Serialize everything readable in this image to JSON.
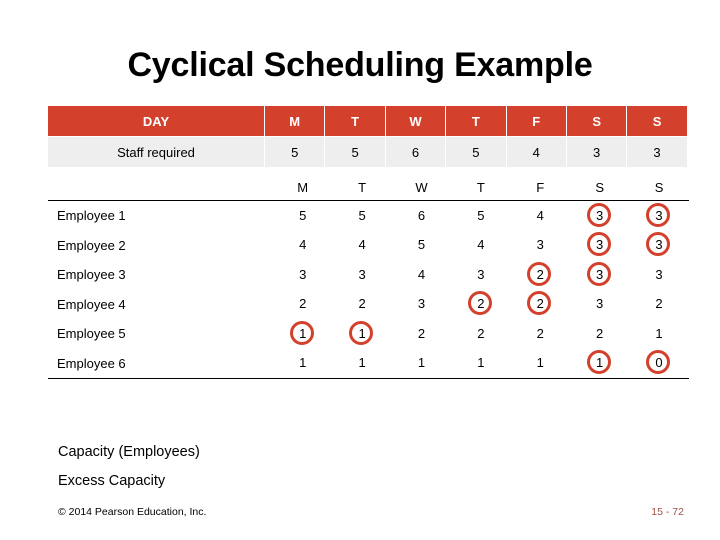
{
  "slide": {
    "title": "Cyclical Scheduling Example",
    "copyright": "© 2014 Pearson Education, Inc.",
    "page_number": "15 - 72",
    "accent_color": "#d3402c",
    "footer_lines": {
      "capacity": "Capacity (Employees)",
      "excess": "Excess Capacity"
    }
  },
  "top_table": {
    "header": {
      "label": "DAY",
      "days": [
        "M",
        "T",
        "W",
        "T",
        "F",
        "S",
        "S"
      ]
    },
    "staff_row": {
      "label": "Staff required",
      "values": [
        "5",
        "5",
        "6",
        "5",
        "4",
        "3",
        "3"
      ]
    }
  },
  "grid": {
    "day_header": {
      "label": "",
      "days": [
        "M",
        "T",
        "W",
        "T",
        "F",
        "S",
        "S"
      ]
    },
    "rows": [
      {
        "name": "Employee 1",
        "values": [
          "5",
          "5",
          "6",
          "5",
          "4",
          "3",
          "3"
        ],
        "circled": [
          false,
          false,
          false,
          false,
          false,
          true,
          true
        ]
      },
      {
        "name": "Employee 2",
        "values": [
          "4",
          "4",
          "5",
          "4",
          "3",
          "3",
          "3"
        ],
        "circled": [
          false,
          false,
          false,
          false,
          false,
          true,
          true
        ]
      },
      {
        "name": "Employee 3",
        "values": [
          "3",
          "3",
          "4",
          "3",
          "2",
          "3",
          "3"
        ],
        "circled": [
          false,
          false,
          false,
          false,
          true,
          true,
          false
        ]
      },
      {
        "name": "Employee 4",
        "values": [
          "2",
          "2",
          "3",
          "2",
          "2",
          "3",
          "2"
        ],
        "circled": [
          false,
          false,
          false,
          true,
          true,
          false,
          false
        ]
      },
      {
        "name": "Employee 5",
        "values": [
          "1",
          "1",
          "2",
          "2",
          "2",
          "2",
          "1"
        ],
        "circled": [
          true,
          true,
          false,
          false,
          false,
          false,
          false
        ]
      },
      {
        "name": "Employee 6",
        "values": [
          "1",
          "1",
          "1",
          "1",
          "1",
          "1",
          "0"
        ],
        "circled": [
          false,
          false,
          false,
          false,
          false,
          true,
          true
        ]
      }
    ]
  }
}
